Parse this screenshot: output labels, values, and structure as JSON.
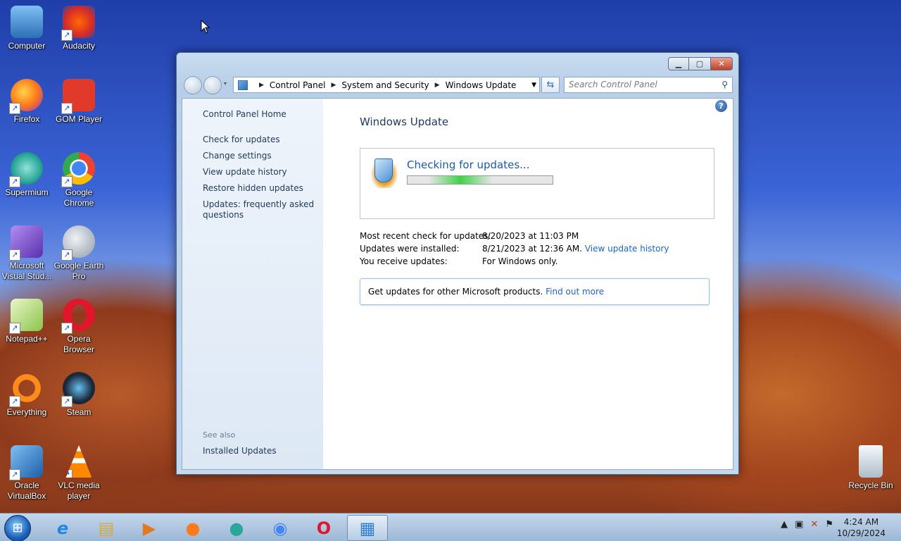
{
  "desktop": {
    "icons": [
      {
        "label": "Computer",
        "icon": "computer-icon",
        "color": "#4f9be0"
      },
      {
        "label": "Audacity",
        "icon": "audacity-icon",
        "color": "#f0a020"
      },
      {
        "label": "Firefox",
        "icon": "firefox-icon",
        "color": "#ff7a1a"
      },
      {
        "label": "GOM Player",
        "icon": "gom-player-icon",
        "color": "#e23a2a"
      },
      {
        "label": "Supermium",
        "icon": "supermium-icon",
        "color": "#2aa79a"
      },
      {
        "label": "Google Chrome",
        "icon": "chrome-icon",
        "color": "#4285f4"
      },
      {
        "label": "Microsoft Visual Stud...",
        "icon": "visual-studio-icon",
        "color": "#7a4fc9"
      },
      {
        "label": "Google Earth Pro",
        "icon": "google-earth-icon",
        "color": "#bcc6cf"
      },
      {
        "label": "Notepad++",
        "icon": "notepadpp-icon",
        "color": "#8bc34a"
      },
      {
        "label": "Opera Browser",
        "icon": "opera-icon",
        "color": "#e0162b"
      },
      {
        "label": "Everything",
        "icon": "everything-icon",
        "color": "#ff8c1a"
      },
      {
        "label": "Steam",
        "icon": "steam-icon",
        "color": "#1b2838"
      },
      {
        "label": "Oracle VirtualBox",
        "icon": "virtualbox-icon",
        "color": "#2f7fd1"
      },
      {
        "label": "VLC media player",
        "icon": "vlc-icon",
        "color": "#ff8800"
      },
      {
        "label": "Recycle Bin",
        "icon": "recycle-bin-icon",
        "color": "#d8e4ee"
      }
    ]
  },
  "window": {
    "address": {
      "segments": [
        "Control Panel",
        "System and Security",
        "Windows Update"
      ]
    },
    "search_placeholder": "Search Control Panel",
    "sidebar": {
      "home": "Control Panel Home",
      "links": [
        "Check for updates",
        "Change settings",
        "View update history",
        "Restore hidden updates",
        "Updates: frequently asked questions"
      ],
      "see_also_label": "See also",
      "see_also_links": [
        "Installed Updates"
      ]
    },
    "main": {
      "title": "Windows Update",
      "status": "Checking for updates...",
      "info": [
        {
          "label": "Most recent check for updates:",
          "value": "8/20/2023 at 11:03 PM",
          "link": ""
        },
        {
          "label": "Updates were installed:",
          "value": "8/21/2023 at 12:36 AM.",
          "link": "View update history"
        },
        {
          "label": "You receive updates:",
          "value": "For Windows only.",
          "link": ""
        }
      ],
      "promo_text": "Get updates for other Microsoft products.",
      "promo_link": "Find out more"
    }
  },
  "taskbar": {
    "pinned": [
      {
        "icon": "internet-explorer-icon",
        "glyph": "e",
        "color": "#1e88e5"
      },
      {
        "icon": "file-explorer-icon",
        "glyph": "▤",
        "color": "#e0b040"
      },
      {
        "icon": "media-player-icon",
        "glyph": "▶",
        "color": "#e07a20"
      },
      {
        "icon": "firefox-icon",
        "glyph": "●",
        "color": "#ff7a1a"
      },
      {
        "icon": "supermium-icon",
        "glyph": "●",
        "color": "#2aa79a"
      },
      {
        "icon": "chrome-icon",
        "glyph": "◉",
        "color": "#4285f4"
      },
      {
        "icon": "opera-icon",
        "glyph": "O",
        "color": "#e0162b"
      },
      {
        "icon": "control-panel-icon",
        "glyph": "▦",
        "color": "#2f7fd1"
      }
    ],
    "clock_time": "4:24 AM",
    "clock_date": "10/29/2024"
  }
}
